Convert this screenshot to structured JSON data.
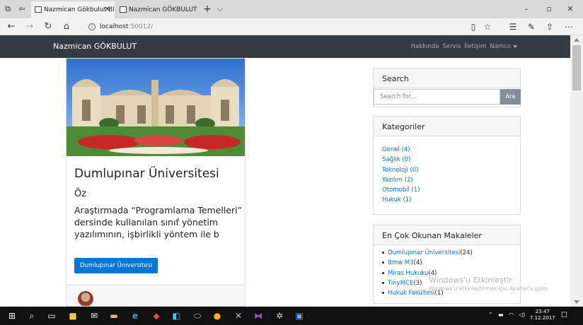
{
  "browser": {
    "tabs": [
      {
        "label": "Nazmican Gökbulut Blo",
        "active": true
      },
      {
        "label": "Nazmican GÖKBULUT Blog",
        "active": false
      }
    ],
    "new_tab_label": "+",
    "tab_menu_label": "⌵",
    "url_host": "localhost",
    "url_port": ":50012/",
    "win_controls": {
      "minimize": "–",
      "maximize": "▫",
      "close": "✕"
    }
  },
  "navbar": {
    "brand": "Nazmican GÖKBULUT",
    "links": [
      "Hakkında",
      "Servis",
      "İletişim",
      "Namco"
    ]
  },
  "post": {
    "title": "Dumlupınar Üniversitesi",
    "subtitle": "Öz",
    "excerpt": "Araştırmada “Programlama Temelleri” dersinde kullanılan sınıf yönetim yazılımının, işbirlikli yöntem ile b",
    "button_label": "Dumlupınar Üniversitesi"
  },
  "search_widget": {
    "title": "Search",
    "placeholder": "Search for...",
    "button_label": "Ara"
  },
  "categories_widget": {
    "title": "Kategoriler",
    "items": [
      "Genel (4)",
      "Sağlık (0)",
      "Teknoloji (0)",
      "Yazılım (2)",
      "Otomobil (1)",
      "Hukuk (1)"
    ]
  },
  "popular_widget": {
    "title": "En Çok Okunan Makaleler",
    "items": [
      {
        "title": "Dumlupınar Üniversitesi",
        "count": "(24)"
      },
      {
        "title": "Bmw M3",
        "count": "(4)"
      },
      {
        "title": "Miras Hukuku",
        "count": "(4)"
      },
      {
        "title": "TinyMCE",
        "count": "(3)"
      },
      {
        "title": "Hukuk Fakültesi",
        "count": "(1)"
      }
    ]
  },
  "watermark": {
    "line1": "Windows'u Etkinleştir",
    "line2": "Windows'u etkinleştirmek için Ayarlar'a gidin."
  },
  "taskbar": {
    "time": "23:47",
    "date": "7.12.2017"
  },
  "colors": {
    "navbar_bg": "#343a40",
    "link": "#0275d8",
    "primary_button": "#0275d8",
    "search_button": "#868e96"
  }
}
